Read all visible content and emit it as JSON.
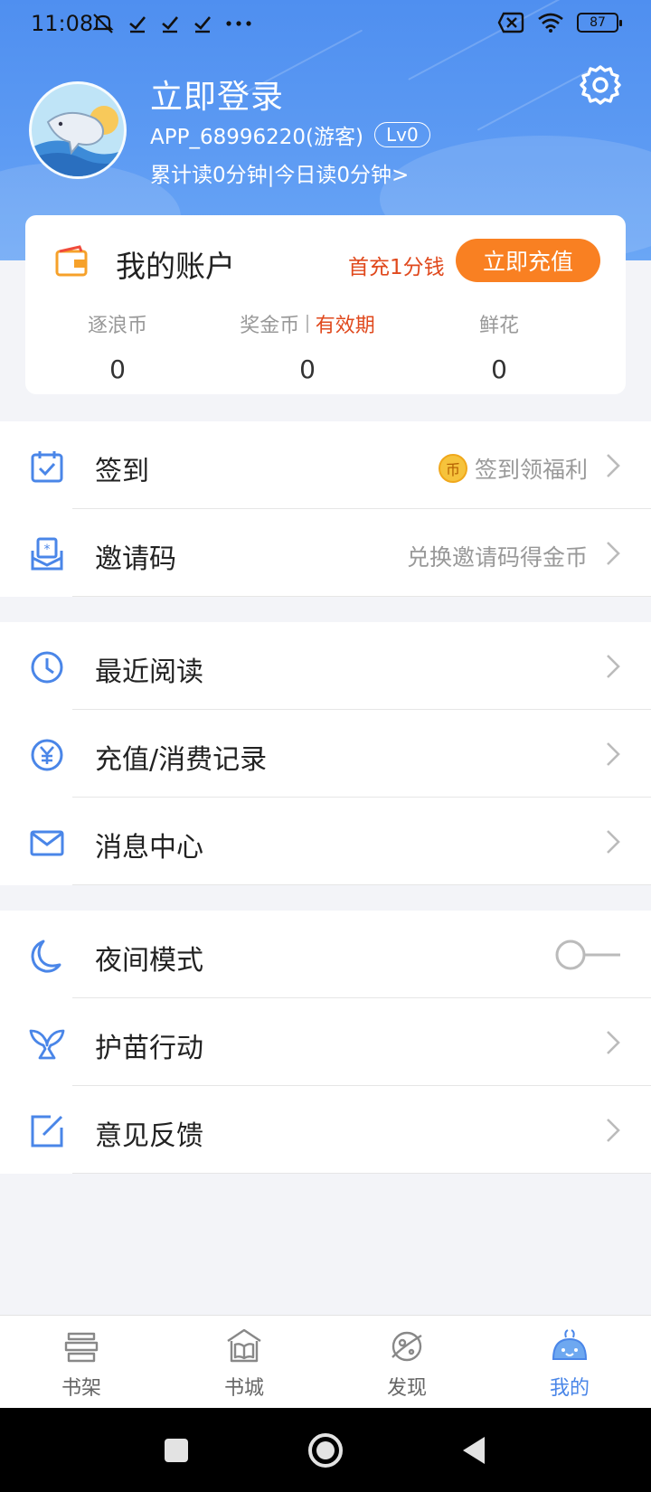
{
  "status_bar": {
    "time": "11:08",
    "battery": "87"
  },
  "profile": {
    "title": "立即登录",
    "user_id": "APP_68996220(游客)",
    "level": "Lv0",
    "read_stats": "累计读0分钟|今日读0分钟>"
  },
  "account": {
    "title": "我的账户",
    "promo": "首充1分钱",
    "recharge_label": "立即充值",
    "coins": {
      "label": "逐浪币",
      "value": "0"
    },
    "bonus": {
      "label": "奖金币",
      "validity": "有效期",
      "value": "0"
    },
    "flowers": {
      "label": "鲜花",
      "value": "0"
    }
  },
  "menu": {
    "checkin": {
      "label": "签到",
      "hint": "签到领福利",
      "coin": "币"
    },
    "invite": {
      "label": "邀请码",
      "hint": "兑换邀请码得金币"
    },
    "recent": {
      "label": "最近阅读"
    },
    "records": {
      "label": "充值/消费记录"
    },
    "messages": {
      "label": "消息中心"
    },
    "night": {
      "label": "夜间模式"
    },
    "sprout": {
      "label": "护苗行动"
    },
    "feedback": {
      "label": "意见反馈"
    }
  },
  "tabs": [
    {
      "label": "书架"
    },
    {
      "label": "书城"
    },
    {
      "label": "发现"
    },
    {
      "label": "我的"
    }
  ],
  "colors": {
    "accent": "#4a86e8",
    "orange": "#f98022",
    "promo_red": "#e0491d"
  }
}
